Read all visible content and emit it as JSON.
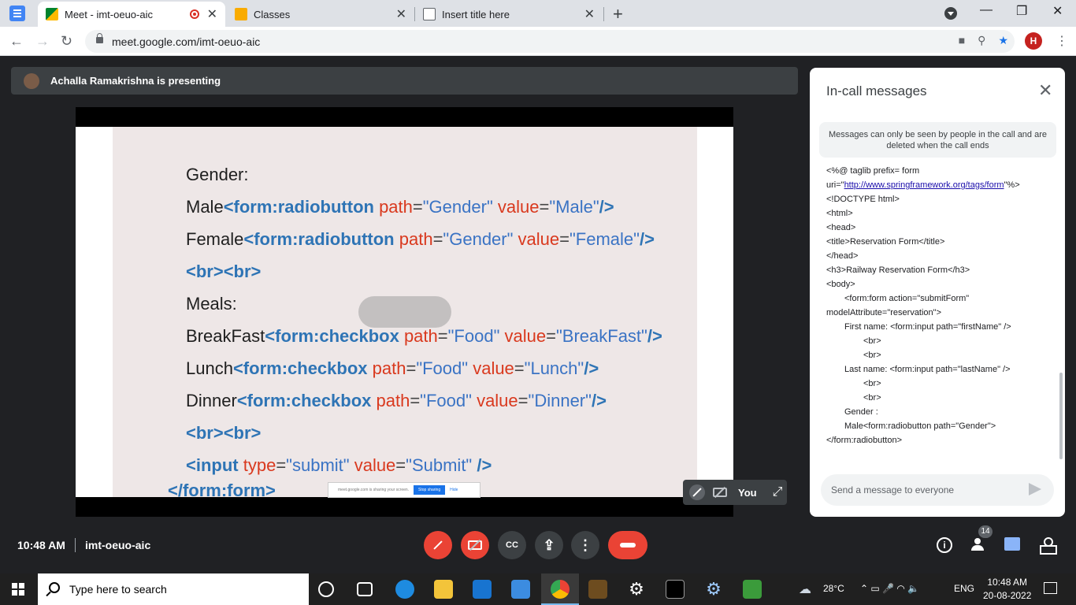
{
  "browser": {
    "tabs": [
      {
        "title": "Meet - imt-oeuo-aic",
        "active": true,
        "recording": true
      },
      {
        "title": "Classes",
        "active": false
      },
      {
        "title": "Insert title here",
        "active": false
      }
    ],
    "url": "meet.google.com/imt-oeuo-aic",
    "profile_initial": "H",
    "icons": {
      "back": "←",
      "forward": "→",
      "reload": "↻",
      "newtab": "+",
      "minimize": "—",
      "restore": "❐",
      "close": "✕",
      "menu": "⋮",
      "camera": "■",
      "zoom": "⚲",
      "bookmark": "★"
    }
  },
  "meet": {
    "presenter_text": "Achalla Ramakrishna is presenting",
    "slide_code": [
      {
        "parts": [
          [
            "cl",
            "Gender:"
          ]
        ]
      },
      {
        "parts": [
          [
            "cl",
            "Male"
          ],
          [
            "tg",
            "<form:radiobutton "
          ],
          [
            "at",
            "path"
          ],
          [
            "eq",
            "="
          ],
          [
            "vl",
            "\"Gender\" "
          ],
          [
            "at",
            "value"
          ],
          [
            "eq",
            "="
          ],
          [
            "vl",
            "\"Male\""
          ],
          [
            "tg",
            "/>"
          ]
        ]
      },
      {
        "parts": [
          [
            "cl",
            "Female"
          ],
          [
            "tg",
            "<form:radiobutton "
          ],
          [
            "at",
            "path"
          ],
          [
            "eq",
            "="
          ],
          [
            "vl",
            "\"Gender\" "
          ],
          [
            "at",
            "value"
          ],
          [
            "eq",
            "="
          ],
          [
            "vl",
            "\"Female\""
          ],
          [
            "tg",
            "/>"
          ]
        ]
      },
      {
        "parts": [
          [
            "tg",
            "<br><br>"
          ]
        ]
      },
      {
        "parts": [
          [
            "cl",
            "Meals:"
          ]
        ]
      },
      {
        "parts": [
          [
            "cl",
            "BreakFast"
          ],
          [
            "tg",
            "<form:checkbox "
          ],
          [
            "at",
            "path"
          ],
          [
            "eq",
            "="
          ],
          [
            "vl",
            "\"Food\" "
          ],
          [
            "at",
            "value"
          ],
          [
            "eq",
            "="
          ],
          [
            "vl",
            "\"BreakFast\""
          ],
          [
            "tg",
            "/>"
          ]
        ]
      },
      {
        "parts": [
          [
            "cl",
            "Lunch"
          ],
          [
            "tg",
            "<form:checkbox "
          ],
          [
            "at",
            "path"
          ],
          [
            "eq",
            "="
          ],
          [
            "vl",
            "\"Food\" "
          ],
          [
            "at",
            "value"
          ],
          [
            "eq",
            "="
          ],
          [
            "vl",
            "\"Lunch\""
          ],
          [
            "tg",
            "/>"
          ]
        ]
      },
      {
        "parts": [
          [
            "cl",
            "Dinner"
          ],
          [
            "tg",
            "<form:checkbox "
          ],
          [
            "at",
            "path"
          ],
          [
            "eq",
            "="
          ],
          [
            "vl",
            "\"Food\" "
          ],
          [
            "at",
            "value"
          ],
          [
            "eq",
            "="
          ],
          [
            "vl",
            "\"Dinner\""
          ],
          [
            "tg",
            "/>"
          ]
        ]
      },
      {
        "parts": [
          [
            "tg",
            "<br><br>"
          ]
        ]
      },
      {
        "parts": [
          [
            "tg",
            "<input "
          ],
          [
            "at",
            "type"
          ],
          [
            "eq",
            "="
          ],
          [
            "vl",
            "\"submit\" "
          ],
          [
            "at",
            "value"
          ],
          [
            "eq",
            "="
          ],
          [
            "vl",
            "\"Submit\" "
          ],
          [
            "tg",
            "/>"
          ]
        ]
      }
    ],
    "slide_last_line": "</form:form>",
    "share_notice": {
      "text": "meet.google.com is sharing your screen.",
      "stop": "Stop sharing",
      "hide": "Hide"
    },
    "self_tile_label": "You",
    "time": "10:48 AM",
    "meeting_code": "imt-oeuo-aic",
    "participants_count": "14",
    "icons": {
      "caption": "CC",
      "present": "⇪",
      "more": "⋮",
      "info": "i",
      "expand": "⤢"
    }
  },
  "chat": {
    "title": "In-call messages",
    "notice": "Messages can only be seen by people in the call and are deleted when the call ends",
    "messages": [
      {
        "indent": 0,
        "text": "<%@ taglib prefix= form"
      },
      {
        "indent": 0,
        "text": "uri=\"",
        "link": "http://www.springframework.org/tags/form",
        "after": "\"%>"
      },
      {
        "indent": 0,
        "text": "<!DOCTYPE html>"
      },
      {
        "indent": 0,
        "text": "<html>"
      },
      {
        "indent": 0,
        "text": "<head>"
      },
      {
        "indent": 0,
        "text": "<title>Reservation Form</title>"
      },
      {
        "indent": 0,
        "text": "</head>"
      },
      {
        "indent": 0,
        "text": "<h3>Railway Reservation Form</h3>"
      },
      {
        "indent": 0,
        "text": "<body>"
      },
      {
        "indent": 1,
        "text": "<form:form action=\"submitForm\""
      },
      {
        "indent": 0,
        "text": "modelAttribute=\"reservation\">"
      },
      {
        "indent": 1,
        "text": "First name: <form:input path=\"firstName\" />"
      },
      {
        "indent": 2,
        "text": "<br>"
      },
      {
        "indent": 2,
        "text": "<br>"
      },
      {
        "indent": 1,
        "text": "Last name: <form:input path=\"lastName\" />"
      },
      {
        "indent": 2,
        "text": "<br>"
      },
      {
        "indent": 2,
        "text": "<br>"
      },
      {
        "indent": 1,
        "text": "Gender :"
      },
      {
        "indent": 1,
        "text": "Male<form:radiobutton path=\"Gender\">"
      },
      {
        "indent": 0,
        "text": "</form:radiobutton>"
      }
    ],
    "input_placeholder": "Send a message to everyone"
  },
  "taskbar": {
    "search_placeholder": "Type here to search",
    "weather": "28°C",
    "language": "ENG",
    "time": "10:48 AM",
    "date": "20-08-2022",
    "tray_icons": "⌃ ▭ 🎤 ◠ 🔈"
  }
}
